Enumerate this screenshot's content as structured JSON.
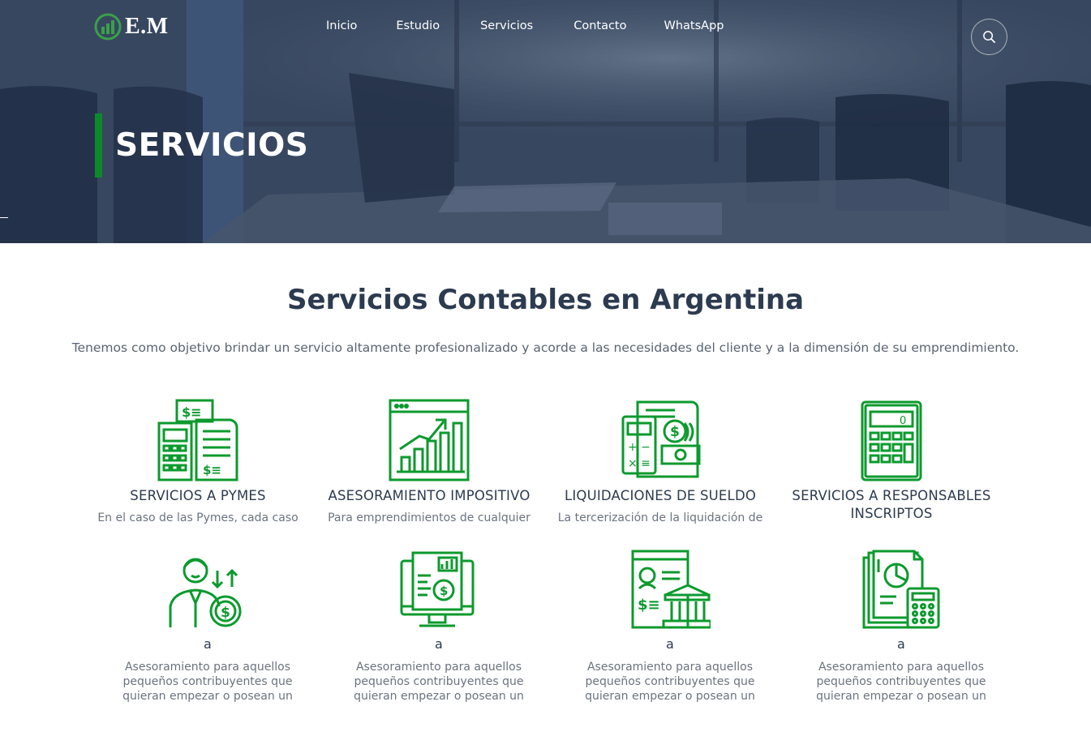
{
  "header": {
    "logo_text": "E.M",
    "nav": [
      {
        "label": "Inicio"
      },
      {
        "label": "Estudio"
      },
      {
        "label": "Servicios"
      },
      {
        "label": "Contacto"
      },
      {
        "label": "WhatsApp"
      }
    ],
    "search_icon": "search-icon"
  },
  "hero": {
    "title": "SERVICIOS"
  },
  "main": {
    "title": "Servicios Contables en Argentina",
    "subtitle": "Tenemos como objetivo brindar un servicio altamente profesionalizado y acorde a las necesidades del cliente y a la dimensión de su emprendimiento.",
    "services_row1": [
      {
        "title": "SERVICIOS A PYMES",
        "desc": "En el caso de las Pymes, cada caso",
        "icon": "calculator-invoice-icon"
      },
      {
        "title": "ASESORAMIENTO IMPOSITIVO",
        "desc": "Para emprendimientos de cualquier",
        "icon": "growth-chart-icon"
      },
      {
        "title": "LIQUIDACIONES DE SUELDO",
        "desc": "La tercerización de la liquidación de",
        "icon": "payroll-icon"
      },
      {
        "title": "SERVICIOS A RESPONSABLES INSCRIPTOS",
        "desc": "",
        "icon": "calculator-icon"
      }
    ],
    "services_row2": [
      {
        "title": "a",
        "desc": "Asesoramiento para aquellos pequeños contribuyentes que quieran empezar o posean un",
        "icon": "businessman-money-icon"
      },
      {
        "title": "a",
        "desc": "Asesoramiento para aquellos pequeños contribuyentes que quieran empezar o posean un",
        "icon": "monitor-report-icon"
      },
      {
        "title": "a",
        "desc": "Asesoramiento para aquellos pequeños contribuyentes que quieran empezar o posean un",
        "icon": "bank-document-icon"
      },
      {
        "title": "a",
        "desc": "Asesoramiento para aquellos pequeños contribuyentes que quieran empezar o posean un",
        "icon": "report-calculator-icon"
      }
    ]
  },
  "colors": {
    "accent_green": "#0c9a2e",
    "heading": "#2c3b4f",
    "hero_overlay": "#3b4a63"
  }
}
